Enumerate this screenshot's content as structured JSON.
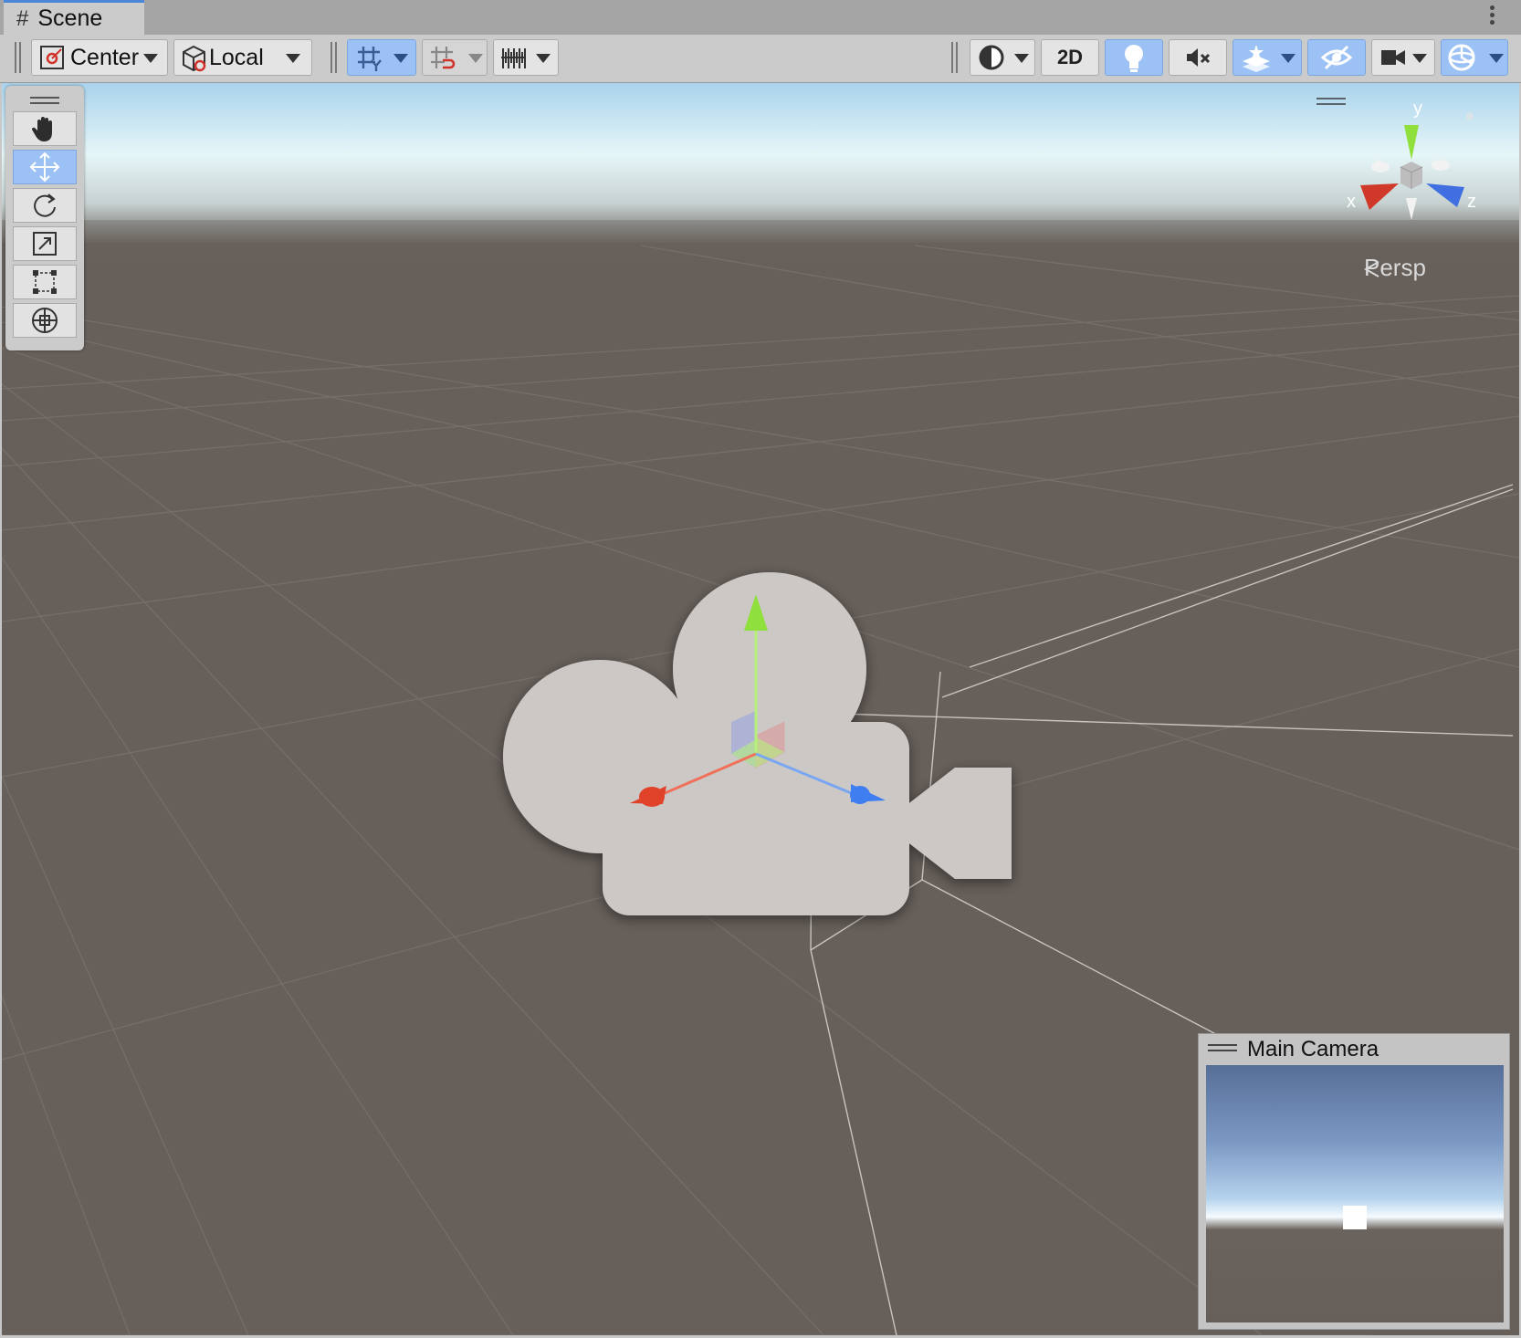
{
  "tab": {
    "title": "Scene",
    "icon": "grid-icon"
  },
  "toolbar": {
    "pivot_label": "Center",
    "space_label": "Local",
    "mode_2d_label": "2D"
  },
  "tools": [
    "hand-tool",
    "move-tool",
    "rotate-tool",
    "scale-tool",
    "rect-tool",
    "transform-tool"
  ],
  "active_tool": "move-tool",
  "gizmo": {
    "x_label": "x",
    "y_label": "y",
    "z_label": "z",
    "projection_label": "Persp"
  },
  "camera_preview": {
    "title": "Main Camera"
  },
  "colors": {
    "accent": "#9cc2f5",
    "axis_x": "#e0432a",
    "axis_y": "#8fe03c",
    "axis_z": "#3f7ef0",
    "ground": "#665f5a"
  }
}
